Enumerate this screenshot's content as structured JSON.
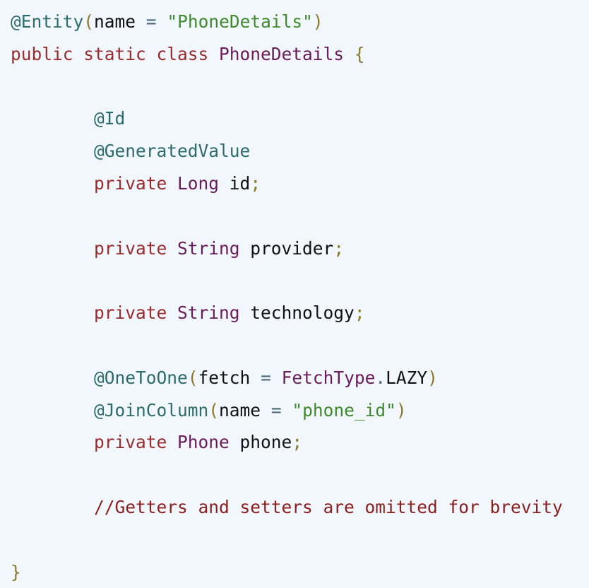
{
  "code": {
    "language": "java",
    "lines": [
      [
        {
          "t": "ann",
          "v": "@Entity"
        },
        {
          "t": "pun",
          "v": "("
        },
        {
          "t": "id",
          "v": "name"
        },
        {
          "t": "op",
          "v": " = "
        },
        {
          "t": "str",
          "v": "\"PhoneDetails\""
        },
        {
          "t": "pun",
          "v": ")"
        }
      ],
      [
        {
          "t": "kw",
          "v": "public static class "
        },
        {
          "t": "ty",
          "v": "PhoneDetails"
        },
        {
          "t": "id",
          "v": " "
        },
        {
          "t": "pun",
          "v": "{"
        }
      ],
      [],
      [
        {
          "t": "id",
          "v": "        "
        },
        {
          "t": "ann",
          "v": "@Id"
        }
      ],
      [
        {
          "t": "id",
          "v": "        "
        },
        {
          "t": "ann",
          "v": "@GeneratedValue"
        }
      ],
      [
        {
          "t": "id",
          "v": "        "
        },
        {
          "t": "kw",
          "v": "private "
        },
        {
          "t": "ty",
          "v": "Long"
        },
        {
          "t": "id",
          "v": " id"
        },
        {
          "t": "pun",
          "v": ";"
        }
      ],
      [],
      [
        {
          "t": "id",
          "v": "        "
        },
        {
          "t": "kw",
          "v": "private "
        },
        {
          "t": "ty",
          "v": "String"
        },
        {
          "t": "id",
          "v": " provider"
        },
        {
          "t": "pun",
          "v": ";"
        }
      ],
      [],
      [
        {
          "t": "id",
          "v": "        "
        },
        {
          "t": "kw",
          "v": "private "
        },
        {
          "t": "ty",
          "v": "String"
        },
        {
          "t": "id",
          "v": " technology"
        },
        {
          "t": "pun",
          "v": ";"
        }
      ],
      [],
      [
        {
          "t": "id",
          "v": "        "
        },
        {
          "t": "ann",
          "v": "@OneToOne"
        },
        {
          "t": "pun",
          "v": "("
        },
        {
          "t": "id",
          "v": "fetch"
        },
        {
          "t": "op",
          "v": " = "
        },
        {
          "t": "ty",
          "v": "FetchType"
        },
        {
          "t": "op",
          "v": "."
        },
        {
          "t": "id",
          "v": "LAZY"
        },
        {
          "t": "pun",
          "v": ")"
        }
      ],
      [
        {
          "t": "id",
          "v": "        "
        },
        {
          "t": "ann",
          "v": "@JoinColumn"
        },
        {
          "t": "pun",
          "v": "("
        },
        {
          "t": "id",
          "v": "name"
        },
        {
          "t": "op",
          "v": " = "
        },
        {
          "t": "str",
          "v": "\"phone_id\""
        },
        {
          "t": "pun",
          "v": ")"
        }
      ],
      [
        {
          "t": "id",
          "v": "        "
        },
        {
          "t": "kw",
          "v": "private "
        },
        {
          "t": "ty",
          "v": "Phone"
        },
        {
          "t": "id",
          "v": " phone"
        },
        {
          "t": "pun",
          "v": ";"
        }
      ],
      [],
      [
        {
          "t": "id",
          "v": "        "
        },
        {
          "t": "cmt",
          "v": "//Getters and setters are omitted for brevity"
        }
      ],
      [],
      [
        {
          "t": "pun",
          "v": "}"
        }
      ]
    ]
  },
  "colors": {
    "background": "#f1f7fd",
    "annotation": "#2e6b6b",
    "keyword": "#9b2b2b",
    "type": "#6a1b5a",
    "string": "#3f8a2c",
    "punctuation": "#8a7a2a",
    "comment": "#8a1f1f",
    "identifier": "#111111"
  }
}
